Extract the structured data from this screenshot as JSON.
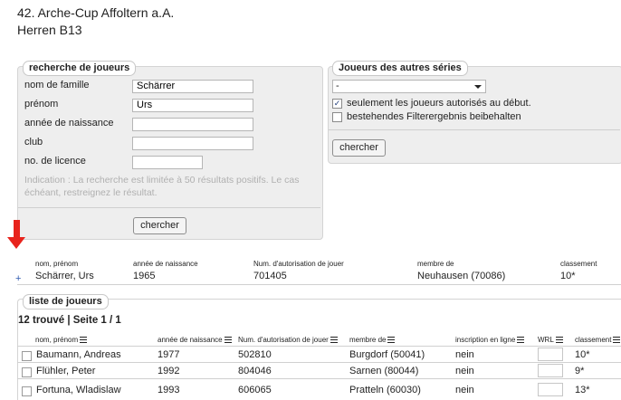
{
  "page": {
    "event_title": "42. Arche-Cup Affoltern a.A.",
    "category": "Herren B13"
  },
  "search": {
    "legend": "recherche de joueurs",
    "fields": [
      {
        "label": "nom de famille",
        "value": "Schärrer"
      },
      {
        "label": "prénom",
        "value": "Urs"
      },
      {
        "label": "année de naissance",
        "value": ""
      },
      {
        "label": "club",
        "value": ""
      },
      {
        "label": "no. de licence",
        "value": ""
      }
    ],
    "hint_line1": "Indication : La recherche est limitée à 50 résultats positifs. Le cas",
    "hint_line2": "échéant, restreignez le résultat.",
    "button": "chercher"
  },
  "other_series": {
    "legend": "Joueurs des autres séries",
    "select_value": "-",
    "option1": {
      "label": "seulement les joueurs autorisés au début.",
      "checked": true
    },
    "option2": {
      "label": "bestehendes Filterergebnis beibehalten",
      "checked": false
    },
    "button": "chercher"
  },
  "result": {
    "headers": {
      "name": "nom, prénom",
      "birth": "année de naissance",
      "license": "Num. d'autorisation de jouer",
      "member": "membre de",
      "ranking": "classement"
    },
    "row": {
      "plus": "+",
      "name": "Schärrer, Urs",
      "birth": "1965",
      "license": "701405",
      "member": "Neuhausen (70086)",
      "ranking": "10*"
    }
  },
  "player_list": {
    "legend": "liste de joueurs",
    "summary": "12 trouvé | Seite 1 / 1",
    "headers": {
      "name": "nom, prénom",
      "birth": "année de naissance",
      "license": "Num. d'autorisation de jouer",
      "member": "membre de",
      "online": "inscription en ligne",
      "wrl": "WRL",
      "ranking": "classement"
    },
    "rows": [
      {
        "name": "Baumann, Andreas",
        "birth": "1977",
        "license": "502810",
        "member": "Burgdorf (50041)",
        "online": "nein",
        "ranking": "10*"
      },
      {
        "name": "Flühler, Peter",
        "birth": "1992",
        "license": "804046",
        "member": "Sarnen (80044)",
        "online": "nein",
        "ranking": "9*"
      },
      {
        "name": "Fortuna, Wladislaw",
        "birth": "1993",
        "license": "606065",
        "member": "Pratteln (60030)",
        "online": "nein",
        "ranking": "13*"
      }
    ]
  },
  "colors": {
    "indicator_arrow": "#e8231c",
    "panel_bg": "#eeeeee",
    "plus_link": "#2f5bb0"
  }
}
